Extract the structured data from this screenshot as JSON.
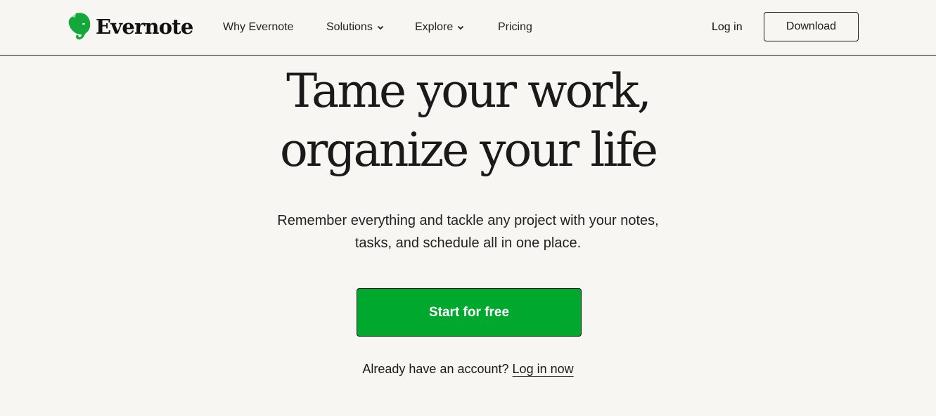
{
  "header": {
    "logo_text": "Evernote",
    "logo_icon": "elephant-icon",
    "nav": [
      {
        "label": "Why Evernote",
        "has_dropdown": false
      },
      {
        "label": "Solutions",
        "has_dropdown": true
      },
      {
        "label": "Explore",
        "has_dropdown": true
      },
      {
        "label": "Pricing",
        "has_dropdown": false
      }
    ],
    "login_label": "Log in",
    "download_label": "Download"
  },
  "hero": {
    "title_line1": "Tame your work,",
    "title_line2": "organize your life",
    "subtitle_line1": "Remember everything and tackle any project with your notes,",
    "subtitle_line2": "tasks, and schedule all in one place.",
    "cta_label": "Start for free",
    "account_prompt": "Already have an account?",
    "account_link": "Log in now"
  },
  "colors": {
    "brand_green": "#00a82d",
    "background": "#f8f6f2",
    "text": "#1a1a1a"
  }
}
